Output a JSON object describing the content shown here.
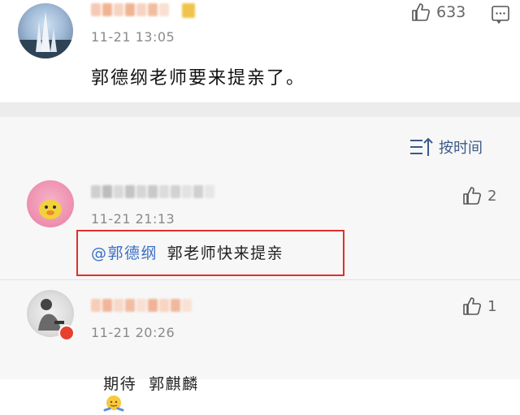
{
  "main_comment": {
    "time": "11-21 13:05",
    "likes": "633",
    "text": "郭德纲老师要来提亲了。"
  },
  "sort": {
    "label": "按时间"
  },
  "replies": [
    {
      "time": "11-21 21:13",
      "likes": "2",
      "mention": "@郭德纲",
      "text": "郭老师快来提亲"
    },
    {
      "time": "11-21 20:26",
      "likes": "1",
      "text": "期待  郭麒麟"
    }
  ],
  "colors": {
    "mention": "#3b6fc2",
    "highlight_border": "#e0302a",
    "sort_text": "#3b5a8a"
  }
}
